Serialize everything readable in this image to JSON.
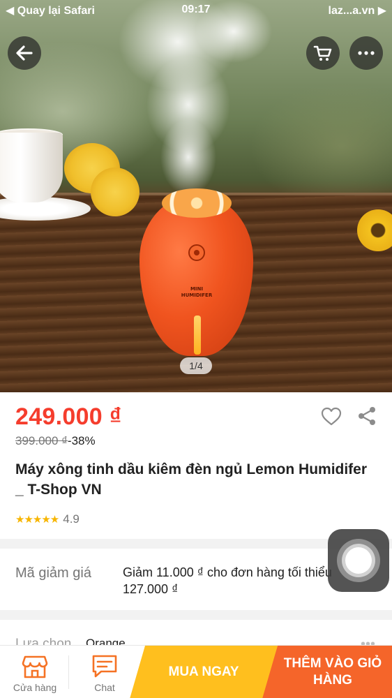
{
  "status_bar": {
    "back_to_app": "◀ Quay lại Safari",
    "time": "09:17",
    "url": "laz...a.vn ▶"
  },
  "top_actions": {
    "back_icon": "arrow-left-icon",
    "cart_icon": "shopping-cart-icon",
    "more_icon": "more-dots-icon"
  },
  "gallery": {
    "counter": "1/4",
    "product_print": [
      "MINI",
      "HUMIDIFER"
    ]
  },
  "product": {
    "price": "249.000 ₫",
    "original_price": "399.000 ₫",
    "discount": "-38%",
    "title": "Máy xông tinh dầu kiêm đèn ngủ Lemon Humidifer _ T-Shop VN",
    "rating": 4.9,
    "rating_display": "4.9",
    "stars": "★★★★★"
  },
  "voucher": {
    "label": "Mã giảm giá",
    "line1": "Giảm 11.000 ₫ cho đơn hàng tối thiểu",
    "line2": "127.000 ₫"
  },
  "variant": {
    "label": "Lựa chọn",
    "value": "Orange",
    "more": "•••"
  },
  "bottom_bar": {
    "store_label": "Cửa hàng",
    "chat_label": "Chat",
    "buy_now": "MUA NGAY",
    "add_to_cart_line1": "THÊM VÀO GIỎ",
    "add_to_cart_line2": "HÀNG"
  },
  "colors": {
    "price": "#f53d2d",
    "buy_now": "#ffbf1e",
    "add_to_cart": "#f5652a",
    "stars": "#f7b500",
    "icon_orange": "#f57224"
  }
}
